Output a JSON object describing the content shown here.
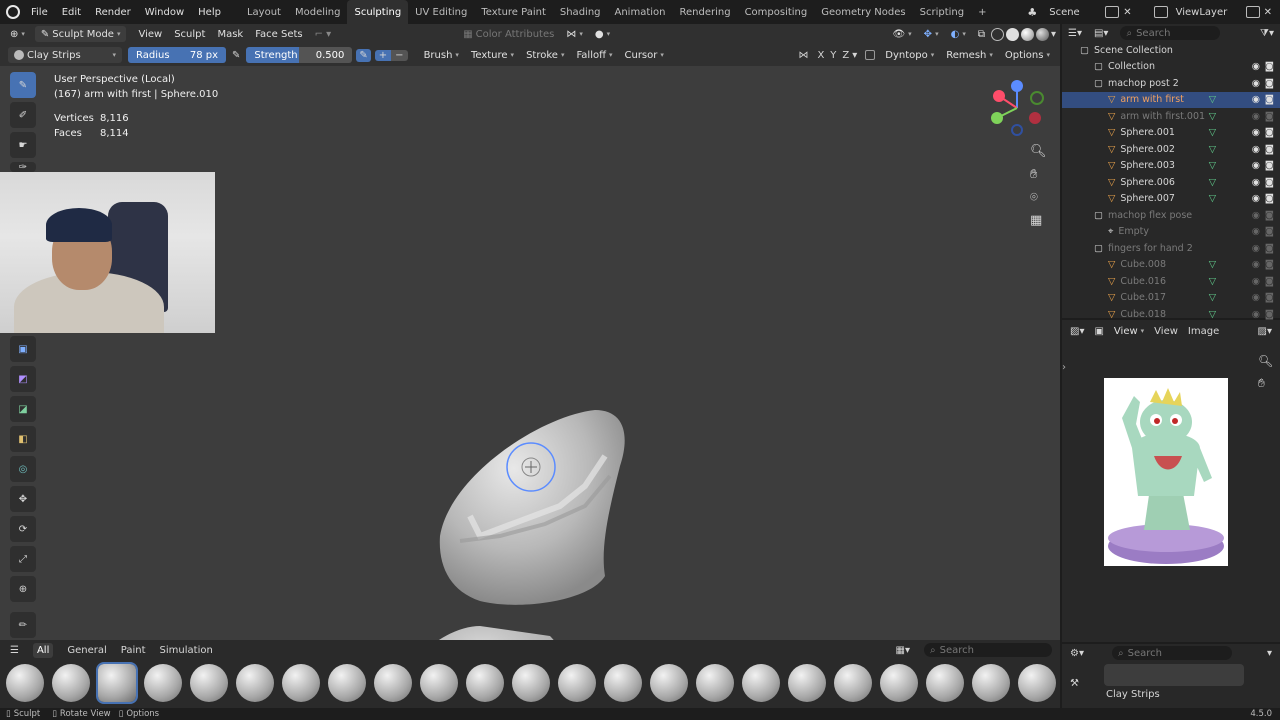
{
  "menu": [
    "File",
    "Edit",
    "Render",
    "Window",
    "Help"
  ],
  "workspaces": [
    "Layout",
    "Modeling",
    "Sculpting",
    "UV Editing",
    "Texture Paint",
    "Shading",
    "Animation",
    "Rendering",
    "Compositing",
    "Geometry Nodes",
    "Scripting"
  ],
  "active_workspace": "Sculpting",
  "scene": "Scene",
  "view_layer": "ViewLayer",
  "header": {
    "mode": "Sculpt Mode",
    "view": "View",
    "sculpt": "Sculpt",
    "mask": "Mask",
    "face_sets": "Face Sets",
    "color_attributes": "Color Attributes"
  },
  "tool_header": {
    "brush_name": "Clay Strips",
    "radius_label": "Radius",
    "radius_value": "78 px",
    "strength_label": "Strength",
    "strength_value": "0.500",
    "brush": "Brush",
    "texture": "Texture",
    "stroke": "Stroke",
    "falloff": "Falloff",
    "cursor": "Cursor",
    "x": "X",
    "y": "Y",
    "z": "Z",
    "dyntopo": "Dyntopo",
    "remesh": "Remesh",
    "options": "Options"
  },
  "overlay": {
    "perspective": "User Perspective (Local)",
    "object": "(167) arm with first | Sphere.010",
    "vertices_label": "Vertices",
    "vertices_value": "8,116",
    "faces_label": "Faces",
    "faces_value": "8,114"
  },
  "outliner": {
    "search_placeholder": "Search",
    "rows": [
      {
        "label": "Scene Collection",
        "dim": false
      },
      {
        "label": "Collection",
        "dim": false
      },
      {
        "label": "machop post 2",
        "dim": false
      },
      {
        "label": "arm with first",
        "dim": false
      },
      {
        "label": "arm with first.001",
        "dim": true
      },
      {
        "label": "Sphere.001",
        "dim": false
      },
      {
        "label": "Sphere.002",
        "dim": false
      },
      {
        "label": "Sphere.003",
        "dim": false
      },
      {
        "label": "Sphere.006",
        "dim": false
      },
      {
        "label": "Sphere.007",
        "dim": false
      },
      {
        "label": "machop flex pose",
        "dim": true
      },
      {
        "label": "Empty",
        "dim": true
      },
      {
        "label": "fingers for hand 2",
        "dim": true
      },
      {
        "label": "Cube.008",
        "dim": true
      },
      {
        "label": "Cube.016",
        "dim": true
      },
      {
        "label": "Cube.017",
        "dim": true
      },
      {
        "label": "Cube.018",
        "dim": true
      }
    ]
  },
  "image_editor": {
    "view": "View",
    "view2": "View",
    "image": "Image"
  },
  "shelf": {
    "tabs": [
      "All",
      "General",
      "Paint",
      "Simulation"
    ],
    "search_placeholder": "Search"
  },
  "props": {
    "search_placeholder": "Search",
    "brush_label": "Clay Strips"
  },
  "status": {
    "left": "Sculpt",
    "middle": "Rotate View",
    "right": "Options",
    "version": "4.5.0"
  },
  "colors": {
    "accent": "#4772b3",
    "selection": "#334d80",
    "viewport_bg": "#3d3d3d"
  }
}
